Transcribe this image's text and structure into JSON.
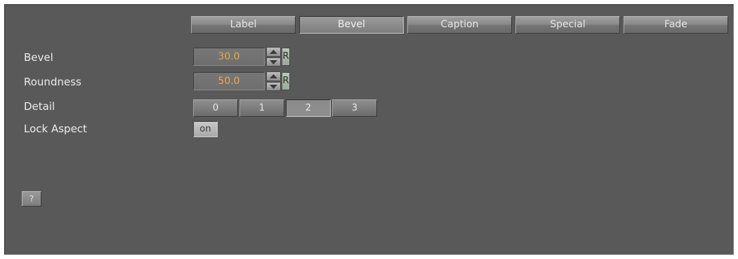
{
  "tabs": [
    {
      "label": "Label",
      "active": false
    },
    {
      "label": "Bevel",
      "active": true
    },
    {
      "label": "Caption",
      "active": false
    },
    {
      "label": "Special",
      "active": false
    },
    {
      "label": "Fade",
      "active": false
    }
  ],
  "fields": {
    "bevel": {
      "label": "Bevel",
      "value": "30.0",
      "reset_label": "R"
    },
    "roundness": {
      "label": "Roundness",
      "value": "50.0",
      "reset_label": "R"
    },
    "detail": {
      "label": "Detail",
      "options": [
        "0",
        "1",
        "2",
        "3"
      ],
      "selected": "2"
    },
    "lock_aspect": {
      "label": "Lock Aspect",
      "toggle_label": "on"
    }
  },
  "help": {
    "label": "?"
  },
  "colors": {
    "panel_background": "#595959",
    "value_text": "#e7a848",
    "label_text": "#ececec"
  }
}
